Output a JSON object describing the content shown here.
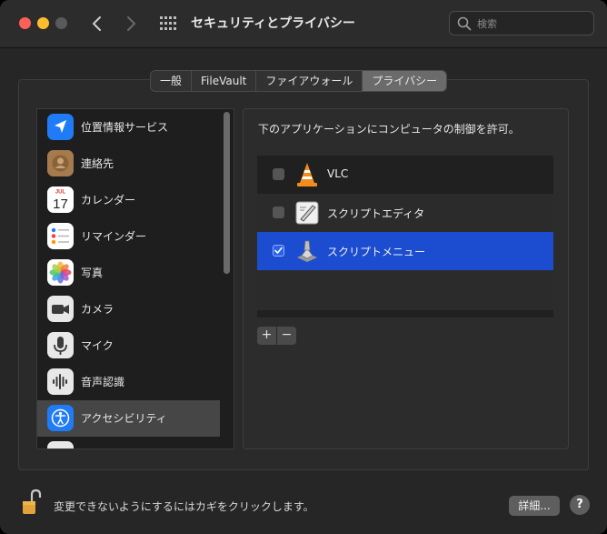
{
  "window": {
    "title": "セキュリティとプライバシー"
  },
  "search": {
    "placeholder": "検索"
  },
  "tabs": [
    {
      "label": "一般"
    },
    {
      "label": "FileVault"
    },
    {
      "label": "ファイアウォール"
    },
    {
      "label": "プライバシー",
      "active": true
    }
  ],
  "sidebar": {
    "items": [
      {
        "label": "位置情報サービス",
        "icon": "location-arrow-icon"
      },
      {
        "label": "連絡先",
        "icon": "contacts-icon"
      },
      {
        "label": "カレンダー",
        "icon": "calendar-icon",
        "calendar_month": "JUL",
        "calendar_day": "17"
      },
      {
        "label": "リマインダー",
        "icon": "reminders-icon"
      },
      {
        "label": "写真",
        "icon": "photos-icon"
      },
      {
        "label": "カメラ",
        "icon": "camera-icon"
      },
      {
        "label": "マイク",
        "icon": "microphone-icon"
      },
      {
        "label": "音声認識",
        "icon": "speech-recognition-icon"
      },
      {
        "label": "アクセシビリティ",
        "icon": "accessibility-icon",
        "selected": true
      }
    ]
  },
  "main": {
    "description": "下のアプリケーションにコンピュータの制御を許可。",
    "apps": [
      {
        "name": "VLC",
        "checked": false,
        "icon": "vlc-cone-icon"
      },
      {
        "name": "スクリプトエディタ",
        "checked": false,
        "icon": "script-editor-icon"
      },
      {
        "name": "スクリプトメニュー",
        "checked": true,
        "selected": true,
        "icon": "script-menu-icon"
      }
    ],
    "add_label": "+",
    "remove_label": "−"
  },
  "footer": {
    "lock_text": "変更できないようにするにはカギをクリックします。",
    "details_label": "詳細...",
    "help_label": "?"
  },
  "colors": {
    "selection_blue": "#1c4dd0",
    "close": "#fe5f57",
    "minimize": "#febc2e"
  }
}
